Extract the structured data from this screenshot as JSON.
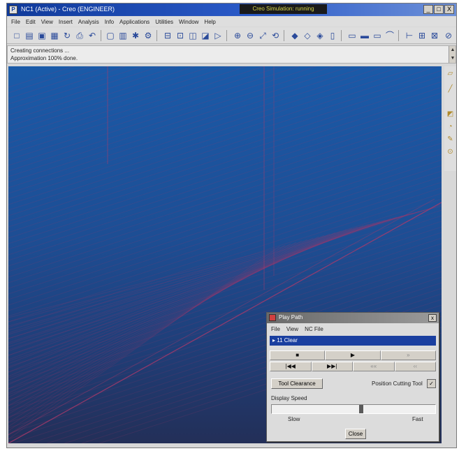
{
  "window": {
    "title": "NC1 (Active) - Creo (ENGINEER)",
    "status_box": "Creo Simulation: running",
    "minimize": "_",
    "maximize": "□",
    "close": "X"
  },
  "menu": [
    "File",
    "Edit",
    "View",
    "Insert",
    "Analysis",
    "Info",
    "Applications",
    "Utilities",
    "Window",
    "Help"
  ],
  "messages": [
    "Creating connections ...",
    "Approximation 100% done."
  ],
  "nc_player": {
    "title": "Play Path",
    "menu": [
      "File",
      "View",
      "NC File"
    ],
    "sequence": "11 Clear",
    "row1": [
      "■",
      "▶",
      "»"
    ],
    "row2": [
      "|◀◀",
      "▶▶|",
      "««",
      "‹‹"
    ],
    "tool_clearance": "Tool Clearance",
    "show_tool_label": "Position Cutting Tool",
    "show_tool_check": "✓",
    "speed_label": "Display Speed",
    "speed_fraction": 0.55,
    "slow": "Slow",
    "fast": "Fast",
    "close": "Close"
  },
  "colors": {
    "toolpath": "#b03a6a",
    "titlebar": "#103a9a"
  }
}
